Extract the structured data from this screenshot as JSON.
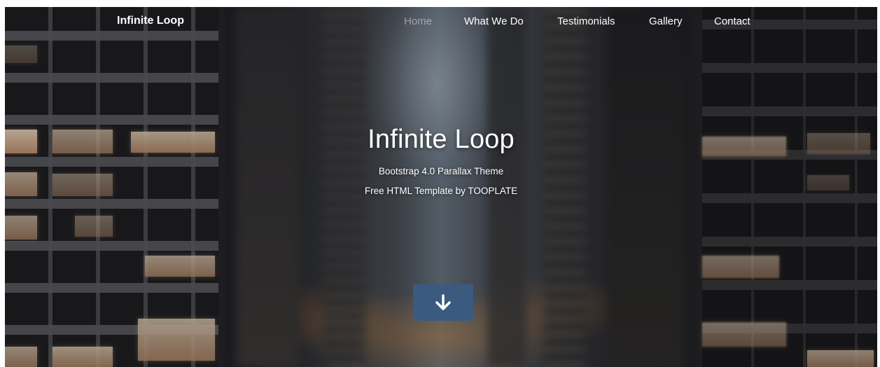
{
  "nav": {
    "brand": "Infinite Loop",
    "items": [
      {
        "label": "Home",
        "active": true
      },
      {
        "label": "What We Do",
        "active": false
      },
      {
        "label": "Testimonials",
        "active": false
      },
      {
        "label": "Gallery",
        "active": false
      },
      {
        "label": "Contact",
        "active": false
      }
    ]
  },
  "hero": {
    "title": "Infinite Loop",
    "subtitle_1": "Bootstrap 4.0 Parallax Theme",
    "subtitle_2": "Free HTML Template by TOOPLATE",
    "scroll_icon": "arrow-down-icon"
  },
  "colors": {
    "button_bg": "#3b5a80",
    "nav_active": "rgba(255,255,255,0.45)",
    "text": "#ffffff"
  }
}
